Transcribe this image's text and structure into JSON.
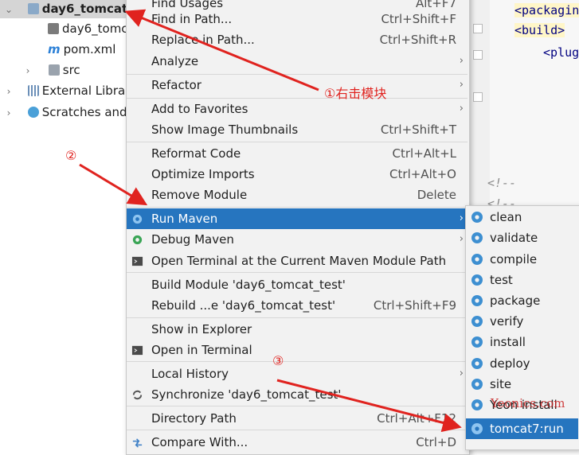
{
  "project_tree": {
    "items": [
      {
        "label": "day6_tomcat",
        "arrow": "⌄",
        "icon": "module-folder-icon"
      },
      {
        "label": "day6_tomc",
        "icon": "file-icon"
      },
      {
        "label": "pom.xml",
        "icon": "maven-icon"
      },
      {
        "label": "src",
        "arrow": "›",
        "icon": "folder-icon"
      },
      {
        "label": "External Librar",
        "arrow": "›",
        "icon": "library-icon"
      },
      {
        "label": "Scratches and",
        "arrow": "›",
        "icon": "scratches-icon"
      }
    ]
  },
  "editor": {
    "lines": [
      "<packagin",
      "<build>",
      "<plug",
      "<!--",
      "<!--"
    ]
  },
  "context_menu": {
    "items": [
      {
        "label": "Find Usages",
        "shortcut": "Alt+F7"
      },
      {
        "label": "Find in Path...",
        "shortcut": "Ctrl+Shift+F"
      },
      {
        "label": "Replace in Path...",
        "shortcut": "Ctrl+Shift+R"
      },
      {
        "label": "Analyze",
        "submenu": "›"
      },
      {
        "label": "Refactor",
        "submenu": "›"
      },
      {
        "label": "Add to Favorites",
        "submenu": "›"
      },
      {
        "label": "Show Image Thumbnails",
        "shortcut": "Ctrl+Shift+T"
      },
      {
        "label": "Reformat Code",
        "shortcut": "Ctrl+Alt+L"
      },
      {
        "label": "Optimize Imports",
        "shortcut": "Ctrl+Alt+O"
      },
      {
        "label": "Remove Module",
        "shortcut": "Delete"
      },
      {
        "label": "Run Maven",
        "submenu": "›"
      },
      {
        "label": "Debug Maven",
        "submenu": "›"
      },
      {
        "label": "Open Terminal at the Current Maven Module Path"
      },
      {
        "label": "Build Module 'day6_tomcat_test'"
      },
      {
        "label": "Rebuild ...e 'day6_tomcat_test'",
        "shortcut": "Ctrl+Shift+F9"
      },
      {
        "label": "Show in Explorer"
      },
      {
        "label": "Open in Terminal"
      },
      {
        "label": "Local History",
        "submenu": "›"
      },
      {
        "label": "Synchronize 'day6_tomcat_test'"
      },
      {
        "label": "Directory Path",
        "shortcut": "Ctrl+Alt+F12"
      },
      {
        "label": "Compare With...",
        "shortcut": "Ctrl+D"
      }
    ]
  },
  "run_maven_submenu": {
    "items": [
      "clean",
      "validate",
      "compile",
      "test",
      "package",
      "verify",
      "install",
      "deploy",
      "site",
      "Yeon install",
      "tomcat7:run"
    ]
  },
  "annotations": {
    "step1": "①右击模块",
    "step2": "②",
    "step3": "③",
    "watermark": "Yeonics.com"
  },
  "colors": {
    "selection": "#2675bf",
    "annotation_red": "#e0231f",
    "maven_gear": "#3d8fd1"
  }
}
